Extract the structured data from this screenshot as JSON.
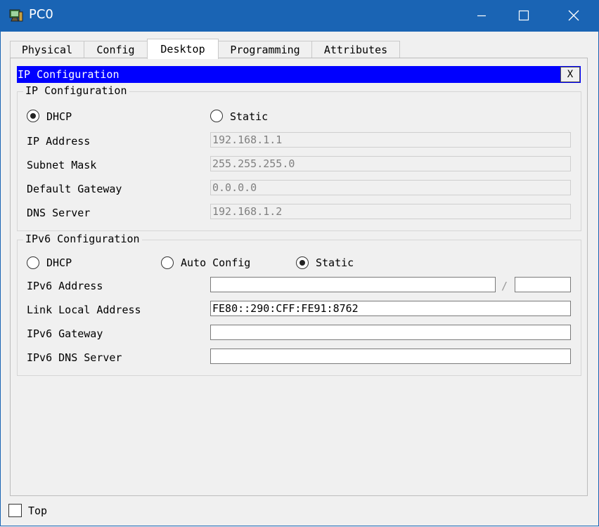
{
  "window": {
    "title": "PC0",
    "icon": "packet-tracer-pc-icon",
    "controls": [
      "minimize-icon",
      "maximize-icon",
      "close-icon"
    ]
  },
  "tabs": [
    {
      "label": "Physical",
      "active": false
    },
    {
      "label": "Config",
      "active": false
    },
    {
      "label": "Desktop",
      "active": true
    },
    {
      "label": "Programming",
      "active": false
    },
    {
      "label": "Attributes",
      "active": false
    }
  ],
  "panel": {
    "title": "IP Configuration",
    "close_label": "X"
  },
  "ipv4": {
    "legend": "IP Configuration",
    "dhcp_label": "DHCP",
    "dhcp_selected": true,
    "static_label": "Static",
    "static_selected": false,
    "ip_address_label": "IP Address",
    "ip_address_value": "192.168.1.1",
    "subnet_mask_label": "Subnet Mask",
    "subnet_mask_value": "255.255.255.0",
    "default_gateway_label": "Default Gateway",
    "default_gateway_value": "0.0.0.0",
    "dns_server_label": "DNS Server",
    "dns_server_value": "192.168.1.2"
  },
  "ipv6": {
    "legend": "IPv6 Configuration",
    "dhcp_label": "DHCP",
    "dhcp_selected": false,
    "auto_config_label": "Auto Config",
    "auto_config_selected": false,
    "static_label": "Static",
    "static_selected": true,
    "address_label": "IPv6 Address",
    "address_value": "",
    "prefix_separator": "/",
    "prefix_value": "",
    "link_local_label": "Link Local Address",
    "link_local_value": "FE80::290:CFF:FE91:8762",
    "gateway_label": "IPv6 Gateway",
    "gateway_value": "",
    "dns_label": "IPv6 DNS Server",
    "dns_value": ""
  },
  "footer": {
    "top_label": "Top",
    "top_checked": false
  },
  "colors": {
    "titlebar": "#1a64b4",
    "panel_header": "#0000ff",
    "background": "#f0f0f0"
  }
}
